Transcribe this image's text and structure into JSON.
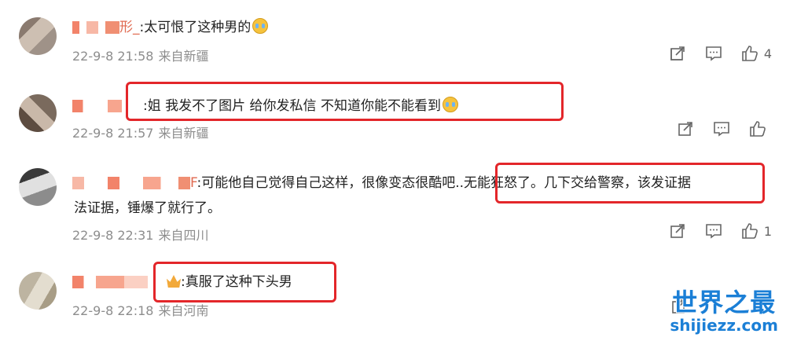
{
  "comments": [
    {
      "username": "形_",
      "text": ":太可恨了这种男的",
      "emoji": "crying-emoji",
      "date": "22-9-8 21:58",
      "location": "来自新疆",
      "likes": "4"
    },
    {
      "username": "",
      "text": ":姐 我发不了图片 给你发私信 不知道你能不能看到",
      "emoji": "crying-emoji",
      "date": "22-9-8 21:57",
      "location": "来自新疆",
      "likes": ""
    },
    {
      "username": "F",
      "text_line1": ":可能他自己觉得自己这样，很像变态很酷吧..无能狂怒了。几下交给警察，该发证据",
      "text_line2": "法证据，锤爆了就行了。",
      "date": "22-9-8 22:31",
      "location": "来自四川",
      "likes": "1"
    },
    {
      "username": "",
      "text": ":真服了这种下头男",
      "badge": "crown-badge",
      "date": "22-9-8 22:18",
      "location": "来自河南",
      "likes": ""
    }
  ],
  "watermark": {
    "title": "世界之最",
    "url": "shijiezz.com"
  },
  "colors": {
    "highlight_box": "#e3262a",
    "watermark": "#1b7fd6",
    "meta_text": "#8d8d8d"
  }
}
